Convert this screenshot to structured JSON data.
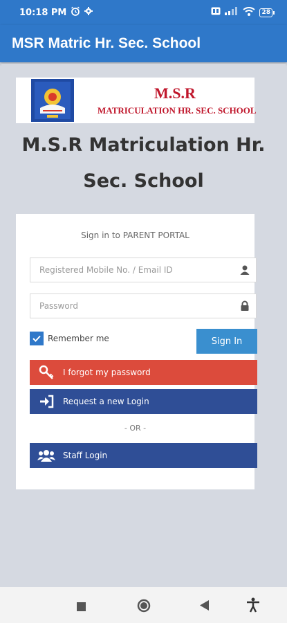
{
  "status_bar": {
    "time": "10:18 PM",
    "battery": "28",
    "icons": [
      "alarm-icon",
      "settings-icon",
      "sim-icon",
      "signal-icon",
      "wifi-icon",
      "battery-icon"
    ]
  },
  "app_bar": {
    "title": "MSR Matric Hr. Sec. School"
  },
  "banner": {
    "line1": "M.S.R",
    "line2": "MATRICULATION HR. SEC. SCHOOL",
    "crest_text": "M.S.R"
  },
  "school_title": {
    "line1": "M.S.R Matriculation Hr.",
    "line2": "Sec. School"
  },
  "login": {
    "caption": "Sign in to PARENT PORTAL",
    "username_placeholder": "Registered Mobile No. / Email ID",
    "password_placeholder": "Password",
    "remember_label": "Remember me",
    "remember_checked": true,
    "signin_label": "Sign In",
    "forgot_label": "I forgot my password",
    "request_label": "Request a new Login",
    "or_label": "- OR -",
    "staff_label": "Staff Login"
  },
  "colors": {
    "app_bar": "#2f78c9",
    "signin_button": "#3a8fcf",
    "forgot_button": "#dc4b3c",
    "blue_buttons": "#2f4e96",
    "banner_text": "#c0172c",
    "background": "#d5d9e1"
  },
  "nav_bar": {
    "icons": [
      "recents-square-icon",
      "home-circle-icon",
      "back-triangle-icon",
      "accessibility-icon"
    ]
  }
}
